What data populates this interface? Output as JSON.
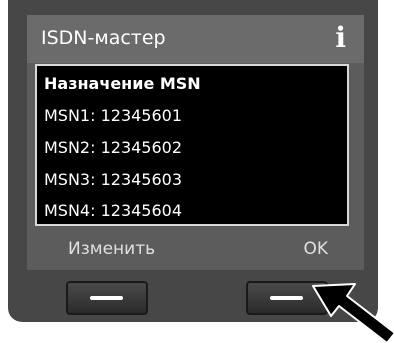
{
  "window": {
    "title": "ISDN-мастер",
    "info_icon": "info-icon"
  },
  "list": {
    "header": "Назначение MSN",
    "items": [
      "MSN1: 12345601",
      "MSN2: 12345602",
      "MSN3: 12345603",
      "MSN4: 12345604"
    ]
  },
  "softkeys": {
    "left_label": "Изменить",
    "right_label": "OK"
  },
  "colors": {
    "bezel": "#474747",
    "screen": "#5c5c5c",
    "list_bg": "#000000",
    "text": "#ffffff"
  }
}
